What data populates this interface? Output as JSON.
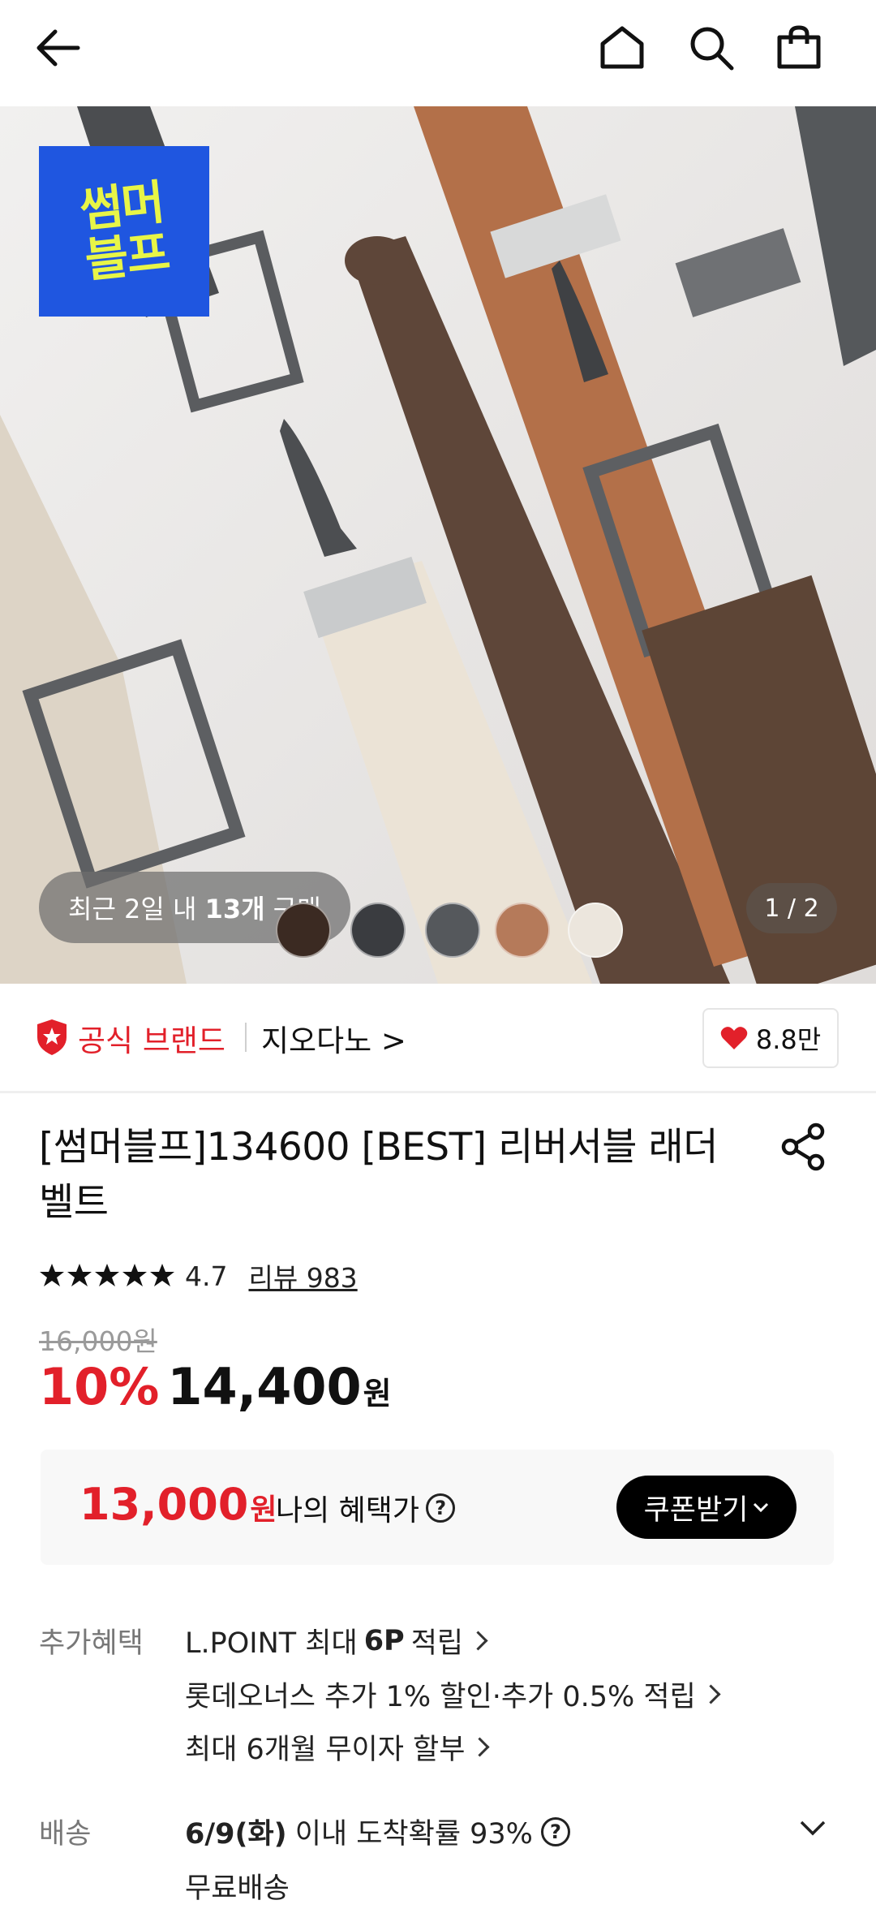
{
  "header": {
    "back_icon": "arrow-left-icon",
    "home_icon": "home-icon",
    "search_icon": "search-icon",
    "cart_icon": "shopping-bag-icon"
  },
  "hero": {
    "promo_badge": "썸머블프",
    "recent_prefix": "최근 2일 내 ",
    "recent_count": "13개",
    "recent_suffix": " 구매",
    "counter": "1 / 2",
    "swatches": [
      "#3b2a22",
      "#3a3c40",
      "#55585c",
      "#b57a5a",
      "#ece6dd"
    ]
  },
  "brand": {
    "official_label": "공식 브랜드",
    "name": "지오다노 >",
    "likes": "8.8만",
    "accent": "#e2202a"
  },
  "product": {
    "title": "[썸머블프]134600 [BEST] 리버서블 래더 벨트",
    "rating": "4.7",
    "review_label": "리뷰 983",
    "original_price": "16,000원",
    "discount": "10%",
    "price": "14,400",
    "currency": "원"
  },
  "benefit": {
    "price": "13,000",
    "currency": "원",
    "label": "나의 혜택가",
    "coupon_button": "쿠폰받기"
  },
  "extra_benefits": {
    "label": "추가혜택",
    "line1_prefix": "L.POINT 최대",
    "line1_bold": "6P",
    "line1_suffix": "적립",
    "line2": "롯데오너스 추가 1% 할인·추가 0.5% 적립",
    "line3": "최대 6개월 무이자 할부"
  },
  "delivery": {
    "label": "배송",
    "date": "6/9(화)",
    "text": "이내 도착확률 93%",
    "free": "무료배송"
  }
}
